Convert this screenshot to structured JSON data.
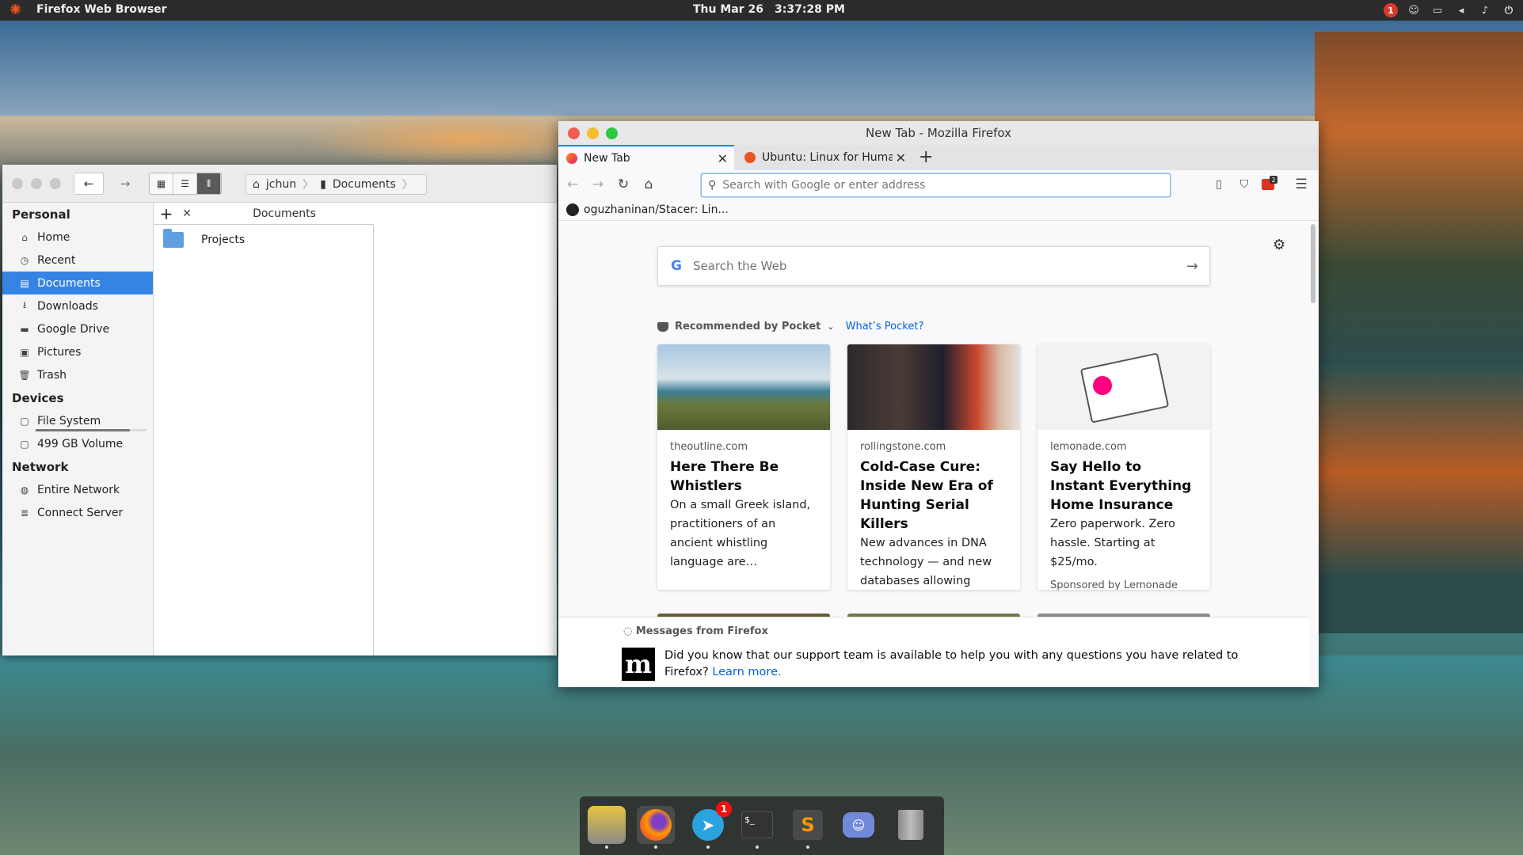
{
  "top_panel": {
    "app_name": "Firefox Web Browser",
    "date": "Thu Mar 26",
    "time": "3:37:28 PM",
    "tray_badge": "1"
  },
  "files": {
    "breadcrumb": [
      "jchun",
      "Documents"
    ],
    "pane_title": "Documents",
    "items": [
      {
        "name": "Projects"
      }
    ],
    "sidebar": {
      "personal_heading": "Personal",
      "personal": [
        {
          "label": "Home",
          "icon": "home-icon"
        },
        {
          "label": "Recent",
          "icon": "clock-icon"
        },
        {
          "label": "Documents",
          "icon": "document-icon",
          "active": true
        },
        {
          "label": "Downloads",
          "icon": "download-icon"
        },
        {
          "label": "Google Drive",
          "icon": "folder-icon"
        },
        {
          "label": "Pictures",
          "icon": "pictures-icon"
        },
        {
          "label": "Trash",
          "icon": "trash-icon"
        }
      ],
      "devices_heading": "Devices",
      "devices": [
        {
          "label": "File System",
          "icon": "drive-icon",
          "usage": 0.85
        },
        {
          "label": "499 GB Volume",
          "icon": "drive-icon"
        }
      ],
      "network_heading": "Network",
      "network": [
        {
          "label": "Entire Network",
          "icon": "globe-icon"
        },
        {
          "label": "Connect Server",
          "icon": "server-icon"
        }
      ]
    }
  },
  "firefox": {
    "window_title": "New Tab - Mozilla Firefox",
    "tabs": [
      {
        "label": "New Tab",
        "active": true
      },
      {
        "label": "Ubuntu: Linux for Human B",
        "active": false
      }
    ],
    "url_placeholder": "Search with Google or enter address",
    "bookmark": "oguzhaninan/Stacer: Lin...",
    "extension_badge": "2",
    "search_placeholder": "Search the Web",
    "pocket_heading": "Recommended by Pocket",
    "pocket_link": "What’s Pocket?",
    "cards": [
      {
        "source": "theoutline.com",
        "title": "Here There Be Whistlers",
        "desc": "On a small Greek island, practitioners of an ancient whistling language are…"
      },
      {
        "source": "rollingstone.com",
        "title": "Cold-Case Cure: Inside New Era of Hunting Serial Killers",
        "desc": "New advances in DNA technology — and new databases allowing law-…"
      },
      {
        "source": "lemonade.com",
        "title": "Say Hello to Instant Everything Home Insurance",
        "desc": "Zero paperwork. Zero hassle. Starting at $25/mo.",
        "sponsor": "Sponsored by Lemonade"
      }
    ],
    "messages_heading": "Messages from Firefox",
    "message_text": "Did you know that our support team is available to help you with any questions you have related to Firefox?",
    "message_link": "Learn more."
  },
  "dock": {
    "items": [
      "files",
      "firefox",
      "telegram",
      "terminal",
      "sublime-text",
      "discord",
      "trash"
    ],
    "telegram_badge": "1"
  }
}
